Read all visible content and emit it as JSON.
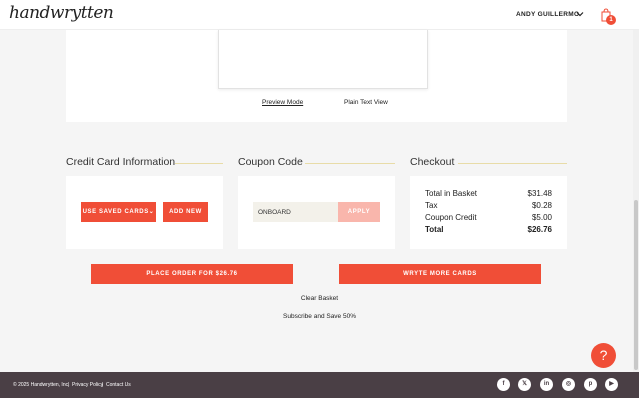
{
  "header": {
    "logo": "handwrytten",
    "user_name": "ANDY GUILLERMO",
    "cart_count": "1"
  },
  "preview": {
    "preview_mode": "Preview Mode",
    "plain_text_view": "Plain Text View"
  },
  "credit_card": {
    "title": "Credit Card Information",
    "use_saved_label": "USE SAVED CARDS",
    "add_new_label": "ADD NEW"
  },
  "coupon": {
    "title": "Coupon Code",
    "value": "ONBOARD",
    "apply_label": "APPLY"
  },
  "checkout": {
    "title": "Checkout",
    "rows": [
      {
        "label": "Total in Basket",
        "value": "$31.48"
      },
      {
        "label": "Tax",
        "value": "$0.28"
      },
      {
        "label": "Coupon Credit",
        "value": "$5.00"
      },
      {
        "label": "Total",
        "value": "$26.76"
      }
    ]
  },
  "actions": {
    "place_order": "PLACE ORDER FOR $26.76",
    "wryte_more": "WRYTE MORE CARDS",
    "clear_basket": "Clear Basket",
    "subscribe": "Subscribe and Save 50%"
  },
  "help": {
    "icon": "question-icon",
    "glyph": "?"
  },
  "footer": {
    "copyright": "© 2025 Handwrytten, Inc.",
    "sep": "|",
    "privacy": "Privacy Policy",
    "contact": "Contact Us",
    "social": [
      {
        "name": "facebook-icon",
        "glyph": "f"
      },
      {
        "name": "x-icon",
        "glyph": "𝕏"
      },
      {
        "name": "linkedin-icon",
        "glyph": "in"
      },
      {
        "name": "instagram-icon",
        "glyph": "◎"
      },
      {
        "name": "pinterest-icon",
        "glyph": "p"
      },
      {
        "name": "youtube-icon",
        "glyph": "▶"
      }
    ]
  },
  "colors": {
    "accent": "#f04e37",
    "accent_disabled": "#f9b6ac",
    "footer_bg": "#4a3f45"
  }
}
